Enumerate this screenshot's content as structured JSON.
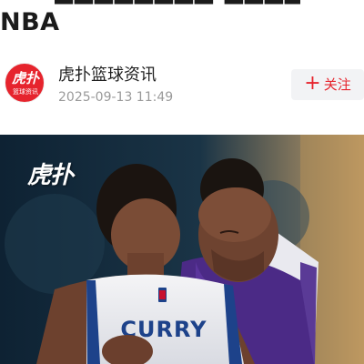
{
  "article": {
    "title": "NBA"
  },
  "author": {
    "name": "虎扑篮球资讯",
    "timestamp": "2025-09-13 11:49",
    "avatar_logo_text": "虎扑",
    "avatar_sub_text": "篮球资讯",
    "avatar_color": "#e6242d"
  },
  "follow": {
    "icon": "plus-icon",
    "label": "关注",
    "plus_glyph": "+",
    "accent_color": "#e6242d"
  },
  "photo": {
    "watermark": "虎扑",
    "jersey_name": "CURRY"
  }
}
